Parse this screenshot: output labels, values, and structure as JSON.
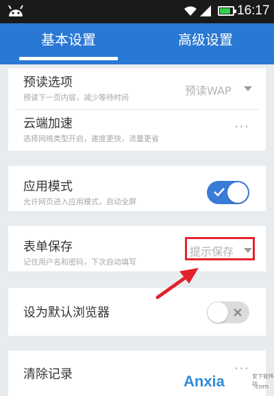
{
  "status_bar": {
    "time": "16:17",
    "battery_level": 0.85,
    "icons": [
      "android-icon",
      "wifi-icon",
      "signal-icon",
      "battery-icon"
    ]
  },
  "tabs": [
    {
      "label": "基本设置",
      "active": true
    },
    {
      "label": "高级设置",
      "active": false
    }
  ],
  "settings": {
    "preload": {
      "title": "预读选项",
      "subtitle": "预读下一页内容，减少等待时间",
      "value": "预读WAP"
    },
    "cloud": {
      "title": "云端加速",
      "subtitle": "选择网络类型开启，速度更快，流量更省",
      "more": "···"
    },
    "app_mode": {
      "title": "应用模式",
      "subtitle": "允许网页进入应用模式，自动全屏",
      "enabled": true
    },
    "form_save": {
      "title": "表单保存",
      "subtitle": "记住用户名和密码，下次自动填写",
      "value": "提示保存"
    },
    "default_browser": {
      "title": "设为默认浏览器",
      "enabled": false
    },
    "clear_history": {
      "title": "清除记录",
      "more": "···"
    }
  },
  "colors": {
    "tab_bar": "#2978d4",
    "toggle_on": "#3a7bd5",
    "annotation": "#e3212b"
  },
  "watermark": {
    "brand": "Anxia",
    "brand_suffix": ".com",
    "tag": "安下软件站"
  }
}
